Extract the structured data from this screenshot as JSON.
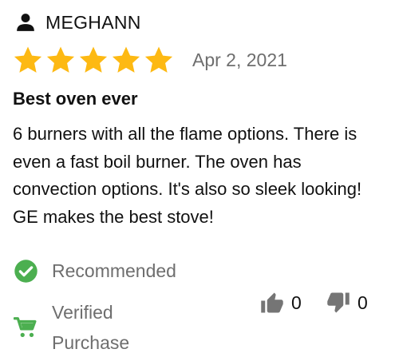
{
  "review": {
    "reviewer_name": "MEGHANN",
    "rating": 5,
    "rating_max": 5,
    "date": "Apr 2, 2021",
    "title": "Best oven ever",
    "body": "6 burners with all the flame options. There is even a fast boil burner. The oven has convection options. It's also so sleek looking! GE makes the best stove!",
    "recommended_label": "Recommended",
    "verified_label": "Verified Purchase",
    "helpful_count": "0",
    "unhelpful_count": "0"
  },
  "icons": {
    "user": "person-icon",
    "star": "star-icon",
    "recommended": "check-circle-icon",
    "verified": "shopping-cart-icon",
    "helpful": "thumbs-up-icon",
    "unhelpful": "thumbs-down-icon"
  },
  "colors": {
    "star": "#FDB913",
    "check": "#4CAF50",
    "cart": "#4CAF50",
    "muted_text": "#6E6E6E",
    "vote_icon": "#757575"
  }
}
